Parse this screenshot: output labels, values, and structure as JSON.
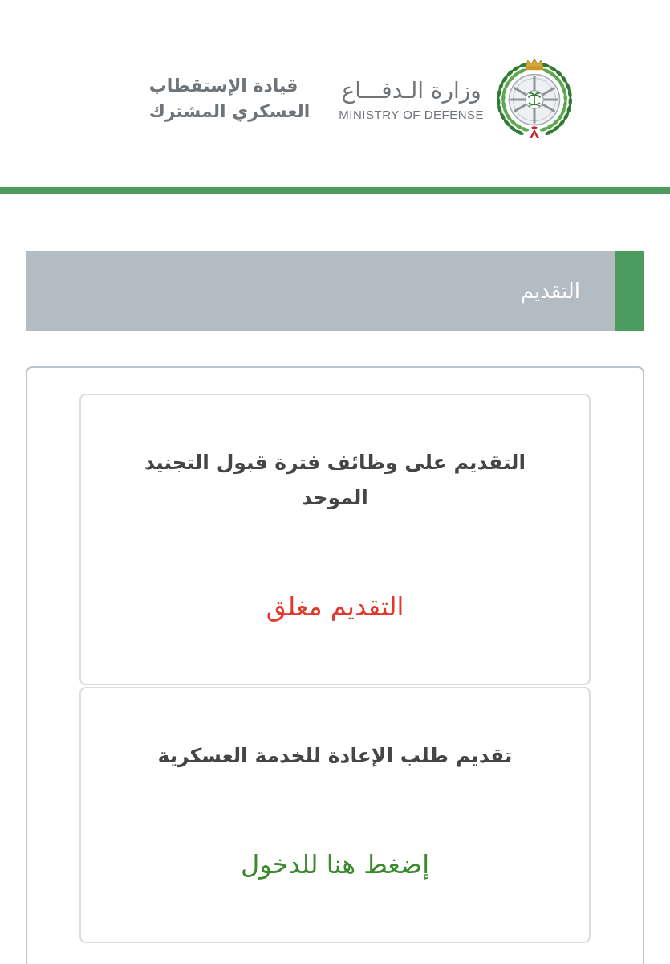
{
  "header": {
    "ministry_arabic": "وزارة الـدفـــاع",
    "ministry_english": "MINISTRY OF DEFENSE",
    "command_lines": [
      "قيادة الإستقطاب",
      "العسكري المشترك"
    ]
  },
  "section": {
    "title": "التقديم"
  },
  "cards": [
    {
      "title": "التقديم على وظائف فترة قبول التجنيد الموحد",
      "status": {
        "kind": "closed",
        "text": "التقديم مغلق"
      }
    },
    {
      "title": "تقديم طلب الإعادة للخدمة العسكرية",
      "status": {
        "kind": "link",
        "text": "إضغط هنا للدخول"
      }
    }
  ]
}
